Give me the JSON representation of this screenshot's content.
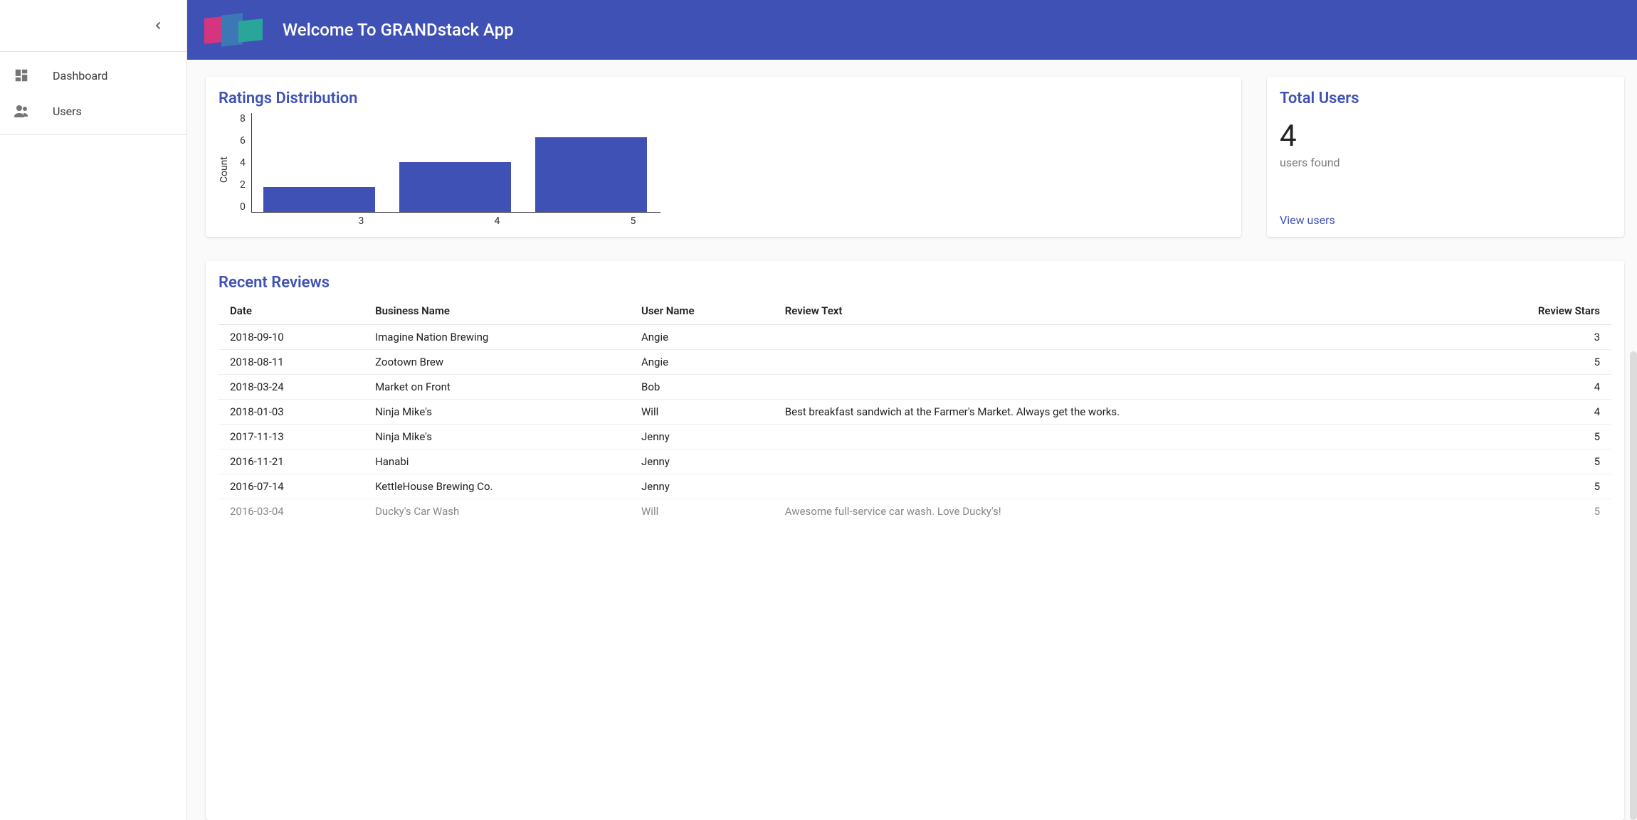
{
  "header": {
    "title": "Welcome To GRANDstack App"
  },
  "sidebar": {
    "items": [
      {
        "label": "Dashboard",
        "icon": "dashboard-icon"
      },
      {
        "label": "Users",
        "icon": "users-icon"
      }
    ]
  },
  "ratings_card": {
    "title": "Ratings Distribution"
  },
  "chart_data": {
    "type": "bar",
    "categories": [
      "3",
      "4",
      "5"
    ],
    "values": [
      2,
      4,
      6
    ],
    "title": "Ratings Distribution",
    "xlabel": "",
    "ylabel": "Count",
    "ylim": [
      0,
      8
    ],
    "yticks": [
      0,
      2,
      4,
      6,
      8
    ]
  },
  "users_card": {
    "title": "Total Users",
    "value": "4",
    "subtext": "users found",
    "link_label": "View users"
  },
  "reviews_card": {
    "title": "Recent Reviews",
    "columns": [
      "Date",
      "Business Name",
      "User Name",
      "Review Text",
      "Review Stars"
    ],
    "rows": [
      {
        "date": "2018-09-10",
        "business": "Imagine Nation Brewing",
        "user": "Angie",
        "text": "",
        "stars": "3"
      },
      {
        "date": "2018-08-11",
        "business": "Zootown Brew",
        "user": "Angie",
        "text": "",
        "stars": "5"
      },
      {
        "date": "2018-03-24",
        "business": "Market on Front",
        "user": "Bob",
        "text": "",
        "stars": "4"
      },
      {
        "date": "2018-01-03",
        "business": "Ninja Mike's",
        "user": "Will",
        "text": "Best breakfast sandwich at the Farmer's Market. Always get the works.",
        "stars": "4"
      },
      {
        "date": "2017-11-13",
        "business": "Ninja Mike's",
        "user": "Jenny",
        "text": "",
        "stars": "5"
      },
      {
        "date": "2016-11-21",
        "business": "Hanabi",
        "user": "Jenny",
        "text": "",
        "stars": "5"
      },
      {
        "date": "2016-07-14",
        "business": "KettleHouse Brewing Co.",
        "user": "Jenny",
        "text": "",
        "stars": "5"
      },
      {
        "date": "2016-03-04",
        "business": "Ducky's Car Wash",
        "user": "Will",
        "text": "Awesome full-service car wash. Love Ducky's!",
        "stars": "5"
      }
    ]
  }
}
